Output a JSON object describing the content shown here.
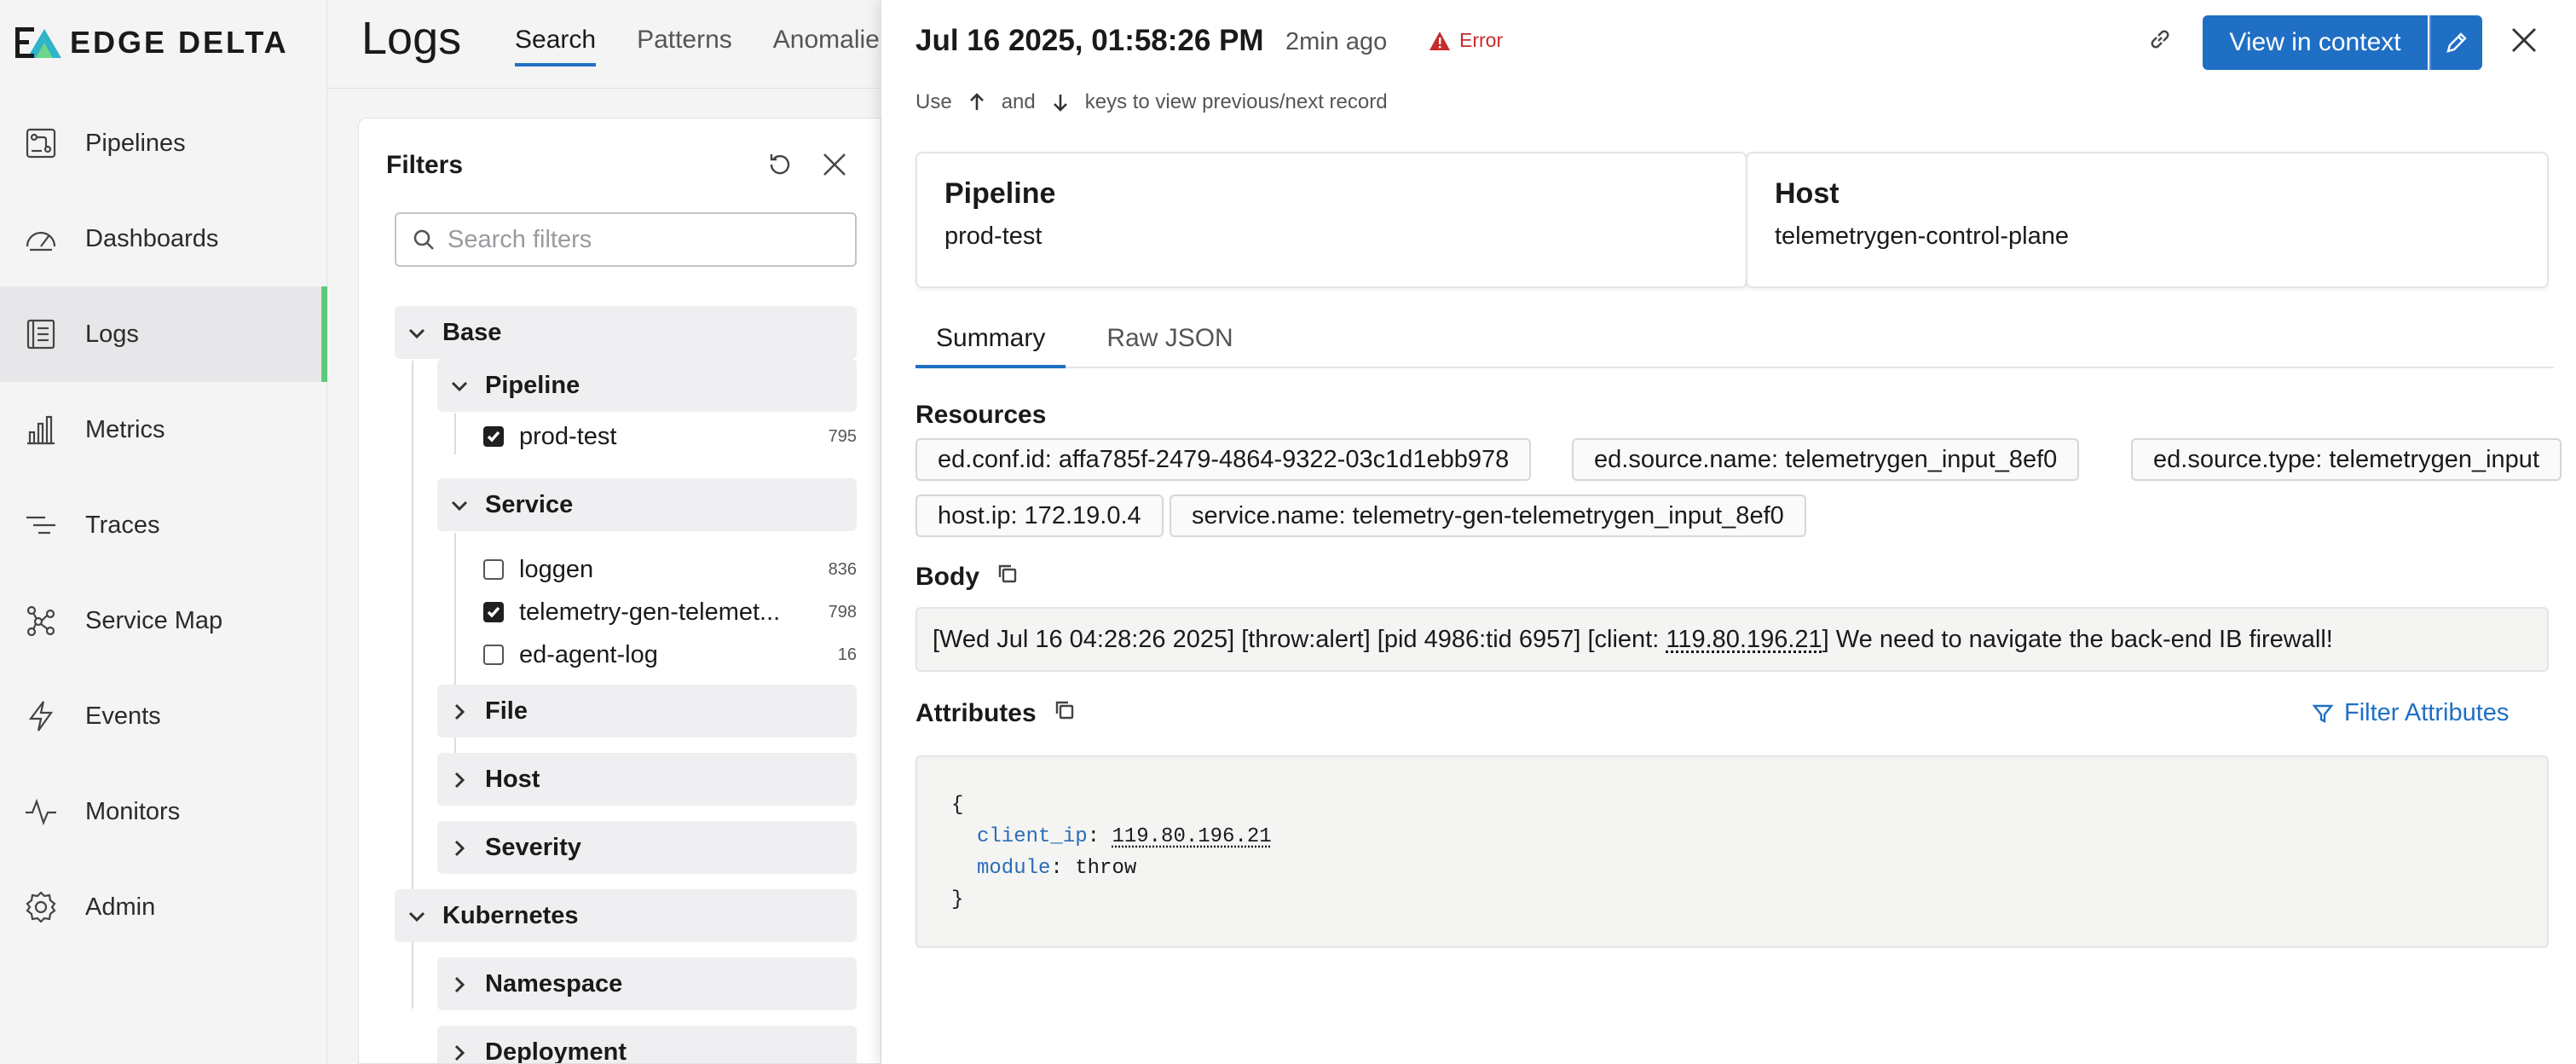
{
  "app": {
    "logo_text": "EDGE DELTA"
  },
  "sidebar": {
    "items": [
      {
        "label": "Pipelines",
        "icon": "pipelines-icon",
        "active": false
      },
      {
        "label": "Dashboards",
        "icon": "dashboards-icon",
        "active": false
      },
      {
        "label": "Logs",
        "icon": "logs-icon",
        "active": true
      },
      {
        "label": "Metrics",
        "icon": "metrics-icon",
        "active": false
      },
      {
        "label": "Traces",
        "icon": "traces-icon",
        "active": false
      },
      {
        "label": "Service Map",
        "icon": "service-map-icon",
        "active": false
      },
      {
        "label": "Events",
        "icon": "events-icon",
        "active": false
      },
      {
        "label": "Monitors",
        "icon": "monitors-icon",
        "active": false
      },
      {
        "label": "Admin",
        "icon": "admin-icon",
        "active": false
      }
    ],
    "active_color": "#5cc97a"
  },
  "logs": {
    "title": "Logs",
    "tabs": [
      {
        "label": "Search",
        "active": true
      },
      {
        "label": "Patterns",
        "active": false
      },
      {
        "label": "Anomalie",
        "active": false
      }
    ]
  },
  "filters": {
    "title": "Filters",
    "search_placeholder": "Search filters",
    "groups": {
      "base": "Base",
      "pipeline": "Pipeline",
      "service": "Service",
      "file": "File",
      "host": "Host",
      "severity": "Severity",
      "kubernetes": "Kubernetes",
      "namespace": "Namespace",
      "deployment": "Deployment"
    },
    "pipeline_items": [
      {
        "label": "prod-test",
        "count": "795",
        "checked": true
      }
    ],
    "service_items": [
      {
        "label": "loggen",
        "count": "836",
        "checked": false
      },
      {
        "label": "telemetry-gen-telemet...",
        "count": "798",
        "checked": true
      },
      {
        "label": "ed-agent-log",
        "count": "16",
        "checked": false
      }
    ]
  },
  "detail": {
    "timestamp": "Jul 16 2025, 01:58:26 PM",
    "relative_time": "2min ago",
    "severity": "Error",
    "severity_color": "#c62b2b",
    "view_in_context_label": "View in context",
    "accent_color": "#1f6fc5",
    "hint": {
      "use": "Use",
      "and": "and",
      "rest": "keys to view previous/next record"
    },
    "pipeline_card": {
      "title": "Pipeline",
      "value": "prod-test"
    },
    "host_card": {
      "title": "Host",
      "value": "telemetrygen-control-plane"
    },
    "tabs": [
      {
        "label": "Summary",
        "active": true
      },
      {
        "label": "Raw JSON",
        "active": false
      }
    ],
    "resources_label": "Resources",
    "resources": [
      "ed.conf.id: affa785f-2479-4864-9322-03c1d1ebb978",
      "ed.source.name: telemetrygen_input_8ef0",
      "ed.source.type: telemetrygen_input",
      "host.ip: 172.19.0.4",
      "service.name: telemetry-gen-telemetrygen_input_8ef0"
    ],
    "body_label": "Body",
    "body": {
      "prefix": "[Wed Jul 16 04:28:26 2025] [throw:alert] [pid 4986:tid 6957] [client: ",
      "ip": "119.80.196.21",
      "suffix": "] We need to navigate the back-end IB firewall!"
    },
    "attributes_label": "Attributes",
    "filter_attributes_label": "Filter Attributes",
    "attributes_json": {
      "open": "{",
      "close": "}",
      "entries": [
        {
          "key": "client_ip",
          "value": "119.80.196.21"
        },
        {
          "key": "module",
          "value": "throw"
        }
      ]
    }
  }
}
